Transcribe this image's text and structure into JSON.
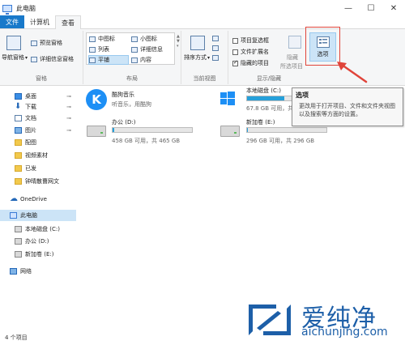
{
  "window": {
    "title": "此电脑"
  },
  "tabs": [
    {
      "label": "文件"
    },
    {
      "label": "计算机"
    },
    {
      "label": "查看"
    }
  ],
  "ribbon": {
    "panes": {
      "label": "窗格",
      "nav_pane": "导航窗格",
      "preview_pane": "预览窗格",
      "details_pane": "详细信息窗格"
    },
    "layout": {
      "label": "布局",
      "items": [
        {
          "label": "中图标"
        },
        {
          "label": "小图标"
        },
        {
          "label": "列表"
        },
        {
          "label": "详细信息"
        },
        {
          "label": "平铺"
        },
        {
          "label": "内容"
        }
      ]
    },
    "current_view": {
      "label": "当前视图",
      "sort_by": "排序方式"
    },
    "show_hide": {
      "label": "显示/隐藏",
      "item_checkboxes": "项目复选框",
      "file_extensions": "文件扩展名",
      "hidden_items": "隐藏的项目",
      "hide": "隐藏",
      "selected_items": "所选项目"
    },
    "options": {
      "label": "选项"
    }
  },
  "tooltip": {
    "title": "选项",
    "description": "更改用于打开项目、文件和文件夹视图以及搜索等方面的设置。"
  },
  "nav": {
    "quick_access": [
      {
        "label": "桌面",
        "pinned": true
      },
      {
        "label": "下载",
        "pinned": true
      },
      {
        "label": "文档",
        "pinned": true
      },
      {
        "label": "图片",
        "pinned": true
      },
      {
        "label": "配图"
      },
      {
        "label": "视频素材"
      },
      {
        "label": "已发"
      },
      {
        "label": "钟晴散曹网文"
      }
    ],
    "onedrive": "OneDrive",
    "this_pc": "此电脑",
    "drives": [
      {
        "label": "本地磁盘 (C:)"
      },
      {
        "label": "办公 (D:)"
      },
      {
        "label": "新加卷 (E:)"
      }
    ],
    "network": "网络"
  },
  "content": {
    "app": {
      "name": "酷狗音乐",
      "subtitle": "听音乐，用酷狗",
      "icon_letter": "K"
    },
    "drives": [
      {
        "name": "本地磁盘 (C:)",
        "info": "67.8 GB 可用，共 150",
        "used_fraction": 0.55
      },
      {
        "name": "办公 (D:)",
        "info": "458 GB 可用，共 465 GB",
        "used_fraction": 0.02
      },
      {
        "name": "新加卷 (E:)",
        "info": "296 GB 可用，共 296 GB",
        "used_fraction": 0.01
      }
    ]
  },
  "status": {
    "count": "4 个项目"
  },
  "watermark": {
    "title": "爱纯净",
    "url": "aichunjing.com"
  },
  "colors": {
    "accent": "#1979ca",
    "highlight": "#e0443a",
    "drive_fill": "#26a0da"
  }
}
